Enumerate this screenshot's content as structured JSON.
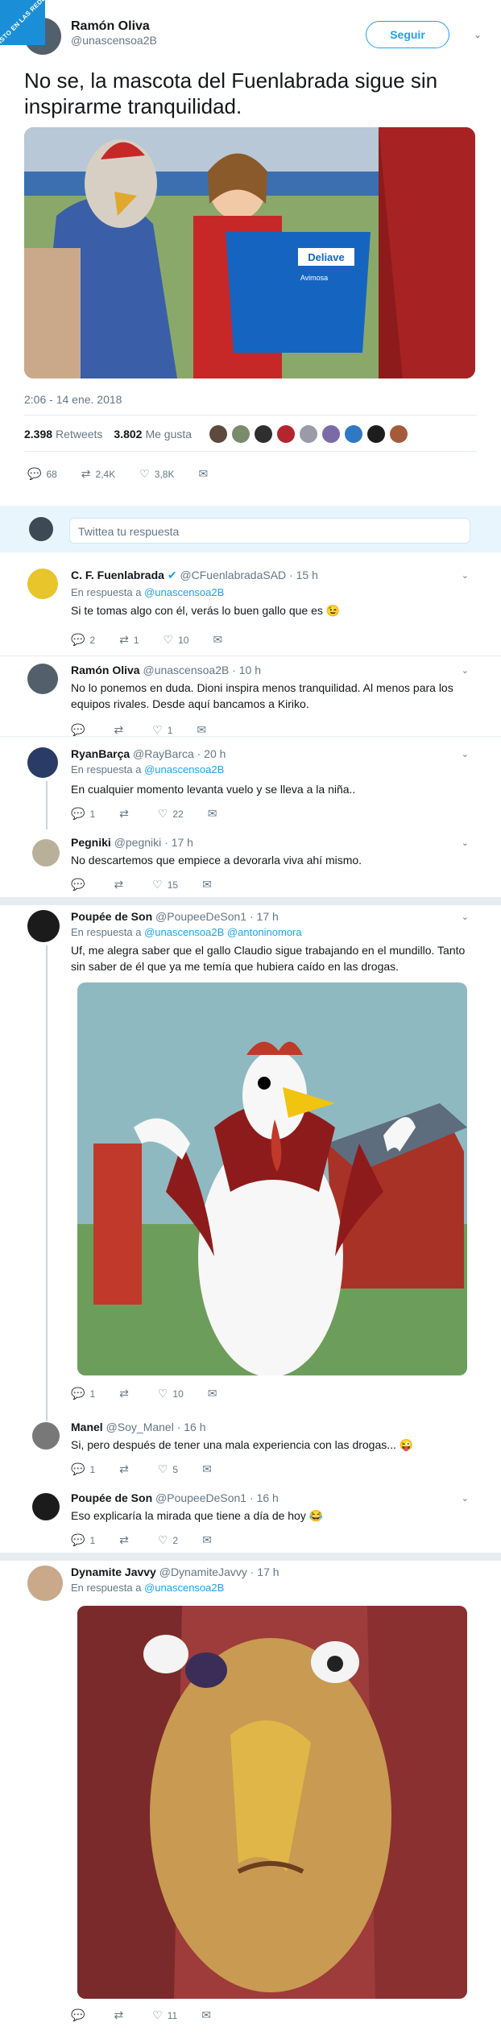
{
  "watermark": "VISTO EN LAS REDES",
  "tweet": {
    "name": "Ramón Oliva",
    "handle": "@unascensoa2B",
    "follow": "Seguir",
    "text": "No se, la mascota del Fuenlabrada sigue sin inspirarme tranquilidad.",
    "timestamp": "2:06 - 14 ene. 2018",
    "retweets_n": "2.398",
    "retweets_l": "Retweets",
    "likes_n": "3.802",
    "likes_l": "Me gusta",
    "reply_count": "68",
    "rt_count": "2,4K",
    "like_count": "3,8K",
    "jersey_sponsor": "Deliave",
    "jersey_sponsor2": "Avimosa"
  },
  "reply_placeholder": "Twittea tu respuesta",
  "in_reply_label": "En respuesta a",
  "replies": [
    {
      "name": "C. F. Fuenlabrada",
      "verified": "✔",
      "handle": "@CFuenlabradaSAD · 15 h",
      "to": "@unascensoa2B",
      "text": "Si te tomas algo con él, verás lo buen gallo que es 😉",
      "r": "2",
      "rt": "1",
      "l": "10"
    },
    {
      "name": "Ramón Oliva",
      "handle": "@unascensoa2B · 10 h",
      "text": "No lo ponemos en duda. Dioni inspira menos tranquilidad. Al menos para los equipos rivales. Desde aquí bancamos a Kiriko.",
      "r": "",
      "rt": "",
      "l": "1"
    },
    {
      "name": "RyanBarça",
      "handle": "@RayBarca · 20 h",
      "to": "@unascensoa2B",
      "text": "En cualquier momento levanta vuelo y se lleva a la niña..",
      "r": "1",
      "rt": "",
      "l": "22"
    },
    {
      "name": "Pegniki",
      "handle": "@pegniki · 17 h",
      "text": "No descartemos que empiece a devorarla viva ahí mismo.",
      "r": "",
      "rt": "",
      "l": "15"
    },
    {
      "name": "Poupée de Son",
      "handle": "@PoupeeDeSon1 · 17 h",
      "to": "@unascensoa2B",
      "to2": "@antoninomora",
      "text": "Uf, me alegra saber que el gallo Claudio sigue trabajando en el mundillo. Tanto sin saber de él que ya me temía que hubiera caído en las drogas.",
      "r": "1",
      "rt": "",
      "l": "10"
    },
    {
      "name": "Manel",
      "handle": "@Soy_Manel · 16 h",
      "text": "Si, pero después de tener una mala experiencia con las drogas... 😜",
      "r": "1",
      "rt": "",
      "l": "5"
    },
    {
      "name": "Poupée de Son",
      "handle": "@PoupeeDeSon1 · 16 h",
      "text": "Eso explicaría la mirada que tiene a día de hoy 😂",
      "r": "1",
      "rt": "",
      "l": "2"
    },
    {
      "name": "Dynamite Javvy",
      "handle": "@DynamiteJavvy · 17 h",
      "to": "@unascensoa2B",
      "text": "",
      "r": "",
      "rt": "",
      "l": "11"
    }
  ],
  "colors": {
    "accent": "#1da1f2",
    "text": "#14171a",
    "muted": "#657786",
    "band": "#e8f5fd"
  }
}
